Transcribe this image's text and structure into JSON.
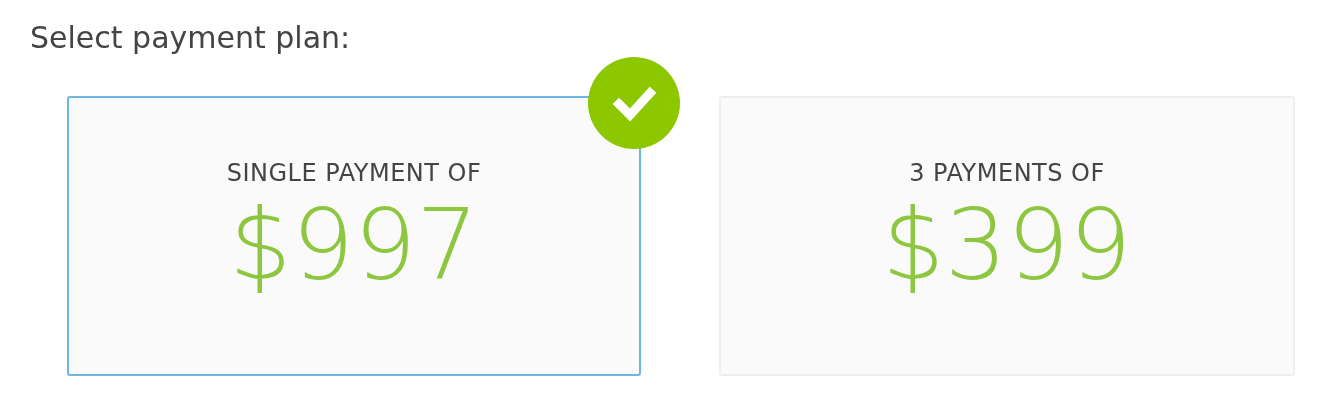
{
  "title": "Select payment plan:",
  "plans": [
    {
      "label": "SINGLE PAYMENT OF",
      "price": "$997",
      "selected": true
    },
    {
      "label": "3 PAYMENTS OF",
      "price": "$399",
      "selected": false
    }
  ]
}
